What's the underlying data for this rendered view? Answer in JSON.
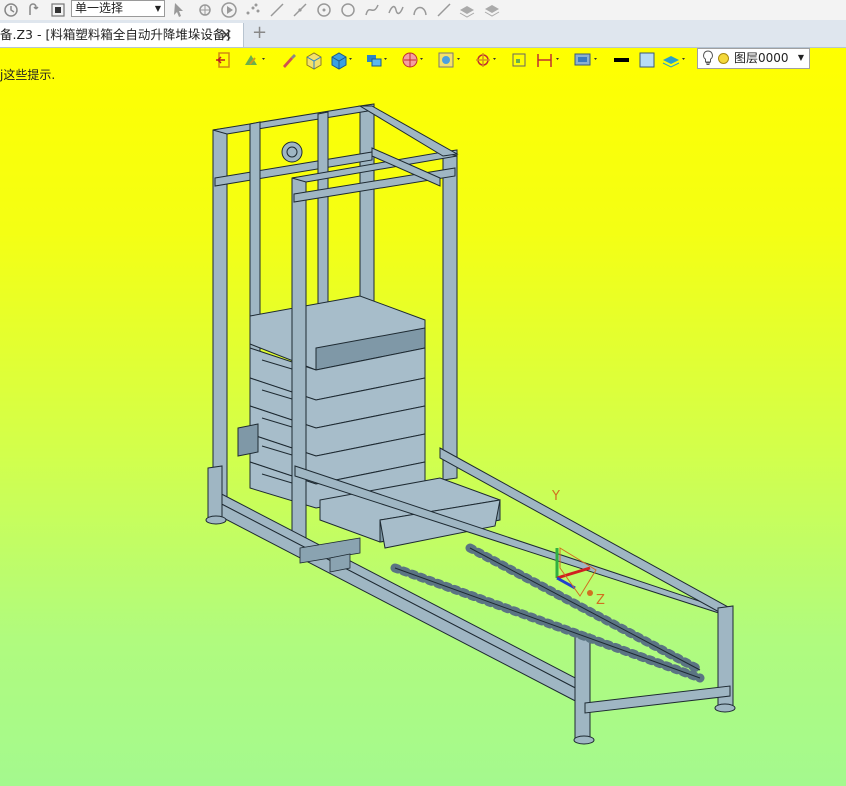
{
  "toolbar": {
    "select_mode": "单一选择",
    "icons": [
      "undo-icon",
      "redo-icon",
      "stop-icon",
      "pick-arrow-icon",
      "pick-filter-icon",
      "play-icon",
      "points-icon",
      "line-icon",
      "line2-icon",
      "circle-icon",
      "circle2-icon",
      "curve-icon",
      "spline-icon",
      "arc-icon",
      "line3-icon",
      "layers-icon",
      "layers2-icon"
    ]
  },
  "tab": {
    "title": "备.Z3 - [料箱塑料箱全自动升降堆垛设备]",
    "close": "✕",
    "new": "+"
  },
  "viewport": {
    "hint": "j这些提示.",
    "layer_name": "图层0000",
    "axes": {
      "y": "Y",
      "z": "Z"
    },
    "colors": {
      "bg_top": "#ffff00",
      "bg_bottom": "#a4f98e",
      "part": "#9fb6c3",
      "edge": "#1e2a32"
    }
  }
}
